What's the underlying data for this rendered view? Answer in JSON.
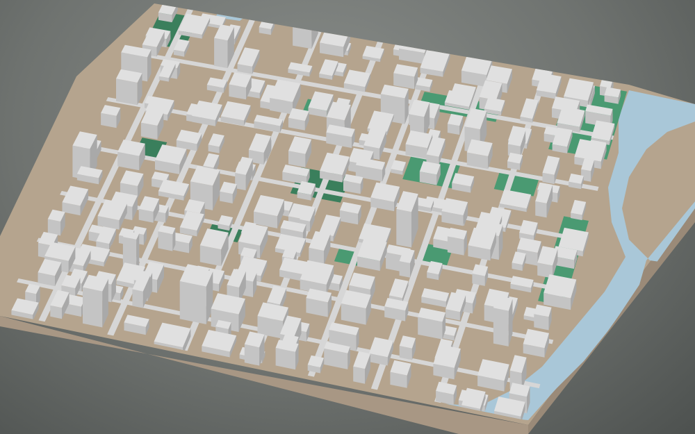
{
  "scene": {
    "kind": "3d-city-model",
    "view": "oblique-aerial",
    "colors": {
      "background": "#6f7370",
      "ground": "#b5a48e",
      "base_side": "#a89784",
      "building_top": "#e0e0e0",
      "building_side": "#c4c4c4",
      "building_dark": "#a9a9a9",
      "park": "#4a9a72",
      "park_dark": "#3a7f5c",
      "water": "#a9c7d8",
      "road": "#d6d6d6"
    },
    "layers": [
      "terrain-base",
      "parks",
      "river",
      "roads",
      "buildings"
    ]
  }
}
